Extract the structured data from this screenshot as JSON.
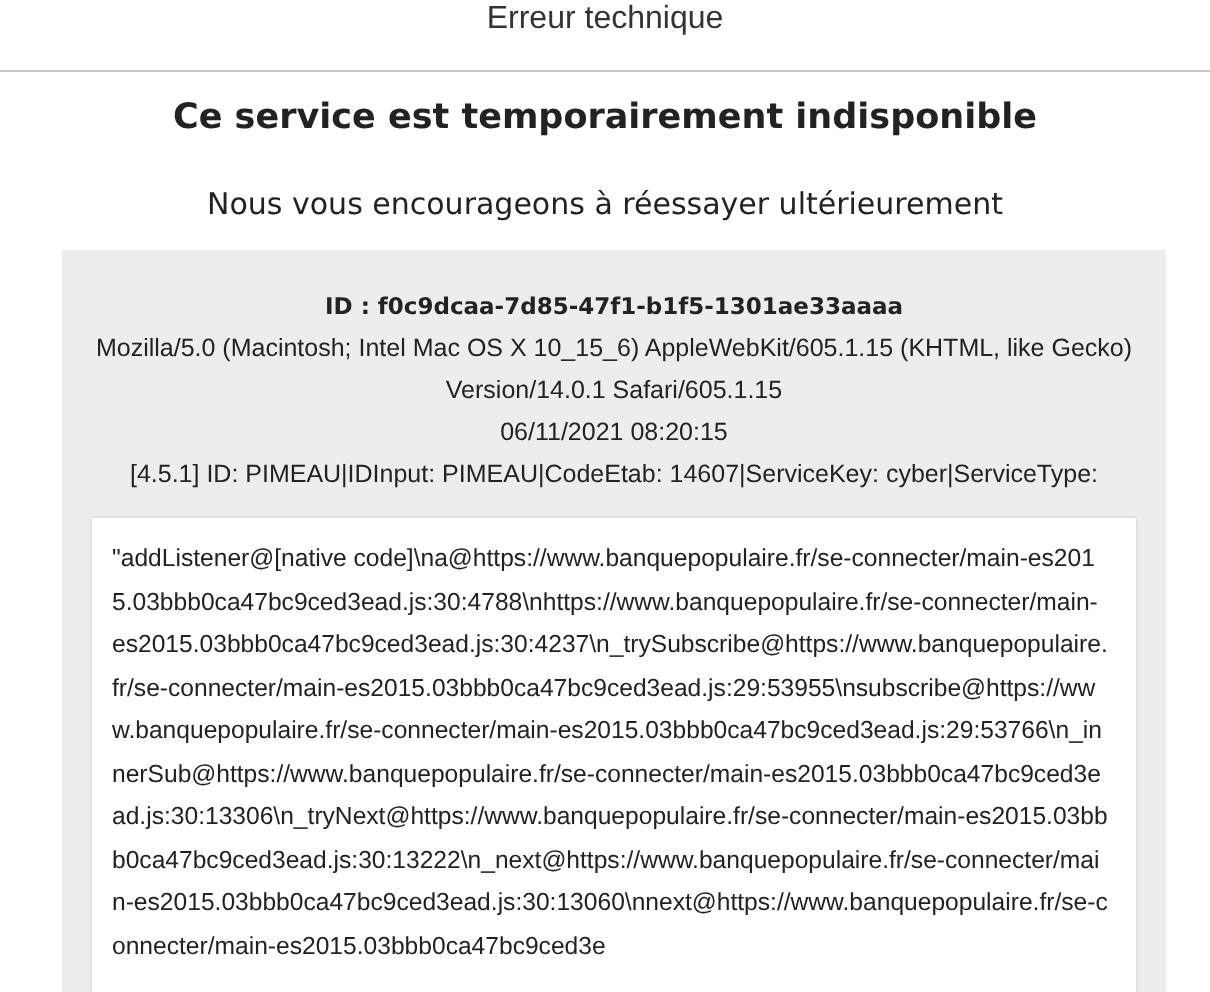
{
  "header": {
    "title": "Erreur technique"
  },
  "message": {
    "title": "Ce service est temporairement indisponible",
    "subtitle": "Nous vous encourageons à réessayer ultérieurement"
  },
  "details": {
    "id": "ID : f0c9dcaa-7d85-47f1-b1f5-1301ae33aaaa",
    "lines": [
      "Mozilla/5.0 (Macintosh; Intel Mac OS X 10_15_6) AppleWebKit/605.1.15 (KHTML, like Gecko) Version/14.0.1 Safari/605.1.15",
      "06/11/2021 08:20:15",
      "[4.5.1] ID: PIMEAU|IDInput: PIMEAU|CodeEtab: 14607|ServiceKey: cyber|ServiceType:"
    ],
    "stack": "\"addListener@[native code]\\na@https://www.banquepopulaire.fr/se-connecter/main-es2015.03bbb0ca47bc9ced3ead.js:30:4788\\nhttps://www.banquepopulaire.fr/se-connecter/main-es2015.03bbb0ca47bc9ced3ead.js:30:4237\\n_trySubscribe@https://www.banquepopulaire.fr/se-connecter/main-es2015.03bbb0ca47bc9ced3ead.js:29:53955\\nsubscribe@https://www.banquepopulaire.fr/se-connecter/main-es2015.03bbb0ca47bc9ced3ead.js:29:53766\\n_innerSub@https://www.banquepopulaire.fr/se-connecter/main-es2015.03bbb0ca47bc9ced3ead.js:30:13306\\n_tryNext@https://www.banquepopulaire.fr/se-connecter/main-es2015.03bbb0ca47bc9ced3ead.js:30:13222\\n_next@https://www.banquepopulaire.fr/se-connecter/main-es2015.03bbb0ca47bc9ced3ead.js:30:13060\\nnext@https://www.banquepopulaire.fr/se-connecter/main-es2015.03bbb0ca47bc9ced3e"
  }
}
